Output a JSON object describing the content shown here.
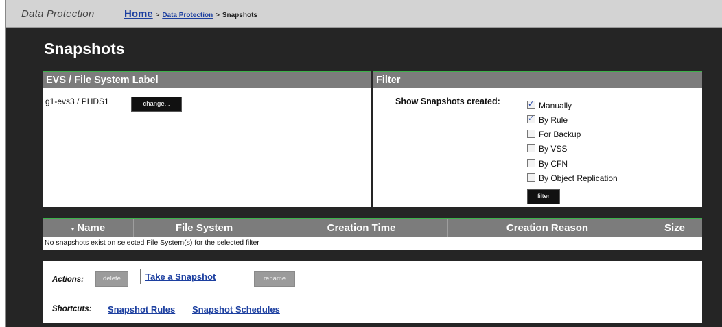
{
  "header": {
    "section": "Data Protection",
    "breadcrumb": {
      "home": "Home",
      "sep1": ">",
      "middle": "Data Protection",
      "sep2": ">",
      "current": "Snapshots"
    }
  },
  "page_title": "Snapshots",
  "evs_panel": {
    "title": "EVS / File System Label",
    "value": "g1-evs3 / PHDS1",
    "change_label": "change..."
  },
  "filter_panel": {
    "title": "Filter",
    "label": "Show Snapshots created:",
    "options": [
      {
        "label": "Manually",
        "checked": true
      },
      {
        "label": "By Rule",
        "checked": true
      },
      {
        "label": "For Backup",
        "checked": false
      },
      {
        "label": "By VSS",
        "checked": false
      },
      {
        "label": "By CFN",
        "checked": false
      },
      {
        "label": "By Object Replication",
        "checked": false
      }
    ],
    "filter_label": "filter"
  },
  "table": {
    "columns": [
      "Name",
      "File System",
      "Creation Time",
      "Creation Reason",
      "Size"
    ],
    "sort_indicator": "▾",
    "empty_message": "No snapshots exist on selected File System(s) for the selected filter"
  },
  "actions": {
    "label": "Actions:",
    "delete": "delete",
    "take_snapshot": "Take a Snapshot",
    "rename": "rename"
  },
  "shortcuts": {
    "label": "Shortcuts:",
    "items": [
      "Snapshot Rules",
      "Snapshot Schedules"
    ]
  },
  "colors": {
    "accent_green": "#3cb24a",
    "link_blue": "#1c3fa0",
    "panel_header": "#7c7c7c",
    "background": "#252525"
  }
}
